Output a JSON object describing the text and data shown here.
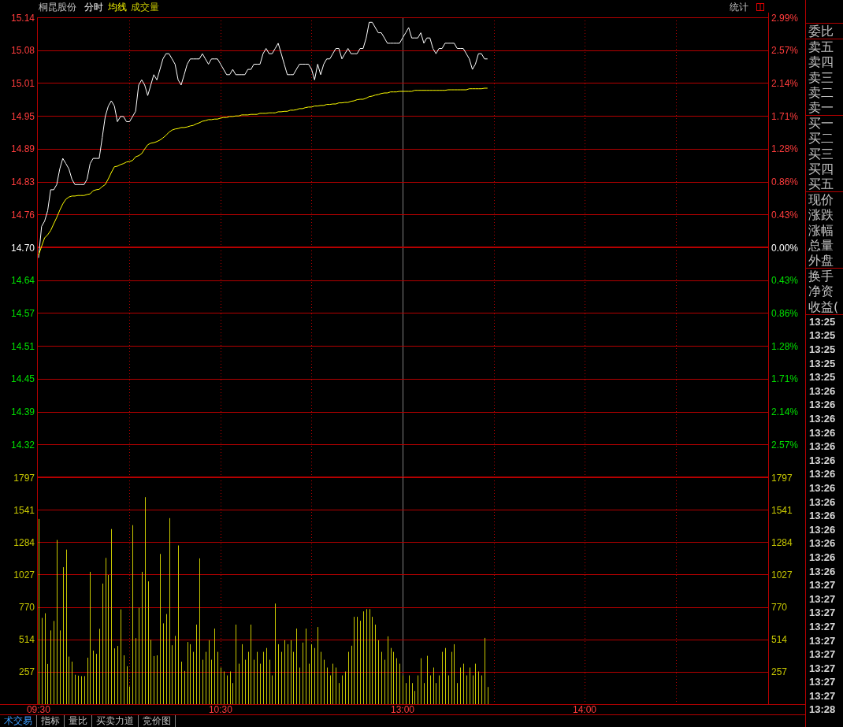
{
  "header": {
    "stock_name": "桐昆股份",
    "stats_label": "统计"
  },
  "price_chart": {
    "chart_data": {
      "type": "line",
      "grid": true,
      "categories": [
        null,
        null,
        null,
        null,
        null,
        null,
        null,
        null,
        null,
        null,
        null,
        null,
        null,
        null,
        null,
        null,
        null,
        null,
        null,
        null,
        null,
        null,
        null,
        null,
        null,
        null,
        null,
        null,
        null,
        null,
        null,
        null,
        null,
        null,
        null,
        null,
        null,
        null,
        null,
        null,
        null,
        null,
        null,
        null,
        null,
        null,
        null,
        null,
        null,
        null,
        null,
        null,
        null,
        null,
        null,
        null,
        null,
        null,
        null,
        null,
        null,
        null,
        null,
        null,
        null,
        null,
        null,
        null,
        null,
        null,
        null,
        null,
        null,
        null,
        null,
        null,
        null,
        null,
        null,
        null,
        null,
        null,
        null,
        null,
        null,
        null,
        null,
        null,
        null,
        null,
        null,
        null,
        null,
        null,
        null,
        null,
        null,
        null,
        null,
        null,
        null,
        null,
        null,
        null,
        null,
        null,
        null,
        null,
        null,
        null,
        null,
        null,
        null,
        null,
        null,
        null,
        null,
        null,
        null,
        null,
        null,
        null,
        null,
        null,
        null,
        null,
        null,
        null,
        null,
        null,
        null,
        null,
        null,
        null,
        null,
        null,
        null,
        null,
        null,
        null,
        null,
        null,
        null,
        null,
        null,
        null,
        null,
        null,
        null,
        null,
        null,
        null,
        null,
        null,
        null,
        null,
        null,
        null,
        null,
        null,
        null,
        null,
        null,
        null,
        null,
        null,
        null,
        null,
        null,
        null,
        null,
        null,
        null,
        null,
        null,
        null,
        null,
        null,
        null,
        null,
        null,
        null,
        null,
        null,
        null,
        null,
        null,
        null,
        null,
        null,
        null,
        null,
        null,
        null,
        null,
        null,
        null,
        null,
        null,
        null,
        null,
        null,
        null,
        null,
        null,
        null,
        null,
        null,
        null,
        null,
        null,
        null,
        null,
        null,
        null,
        null,
        null,
        null,
        null,
        null,
        null,
        null,
        null,
        null,
        null,
        null,
        null,
        null,
        null,
        null,
        null,
        null,
        null,
        null,
        null,
        null,
        null,
        null,
        null,
        null,
        null
      ],
      "ylim": [
        14.2605,
        15.1395
      ],
      "yticks": [
        {
          "value": 15.1395,
          "label": "15.14"
        },
        {
          "value": 15.0767,
          "label": "15.08"
        },
        {
          "value": 15.0139,
          "label": "15.01"
        },
        {
          "value": 14.9512,
          "label": "14.95"
        },
        {
          "value": 14.8884,
          "label": "14.89"
        },
        {
          "value": 14.8256,
          "label": "14.83"
        },
        {
          "value": 14.7628,
          "label": "14.76"
        },
        {
          "value": 14.7,
          "label": "14.70"
        },
        {
          "value": 14.6372,
          "label": "14.64"
        },
        {
          "value": 14.5744,
          "label": "14.57"
        },
        {
          "value": 14.5116,
          "label": "14.51"
        },
        {
          "value": 14.4488,
          "label": "14.45"
        },
        {
          "value": 14.386,
          "label": "14.39"
        },
        {
          "value": 14.3233,
          "label": "14.32"
        }
      ],
      "ref_lines": [
        {
          "axis": "y",
          "value": 14.7
        }
      ],
      "series": [
        {
          "name": "分时",
          "color": "#ffffff",
          "values": [
            14.68,
            14.74,
            14.75,
            14.77,
            14.81,
            14.81,
            14.82,
            14.85,
            14.87,
            14.86,
            14.85,
            14.83,
            14.82,
            14.82,
            14.82,
            14.82,
            14.83,
            14.86,
            14.87,
            14.87,
            14.87,
            14.91,
            14.95,
            14.97,
            14.98,
            14.97,
            14.94,
            14.95,
            14.95,
            14.94,
            14.94,
            14.95,
            14.96,
            15.01,
            15.02,
            15.01,
            14.99,
            15.01,
            15.03,
            15.02,
            15.04,
            15.06,
            15.07,
            15.07,
            15.06,
            15.05,
            15.02,
            15.01,
            15.03,
            15.05,
            15.06,
            15.06,
            15.06,
            15.06,
            15.07,
            15.06,
            15.05,
            15.06,
            15.06,
            15.06,
            15.05,
            15.04,
            15.03,
            15.03,
            15.04,
            15.03,
            15.03,
            15.03,
            15.03,
            15.04,
            15.04,
            15.05,
            15.05,
            15.05,
            15.07,
            15.08,
            15.07,
            15.07,
            15.08,
            15.09,
            15.07,
            15.05,
            15.03,
            15.03,
            15.03,
            15.04,
            15.05,
            15.05,
            15.05,
            15.05,
            15.04,
            15.02,
            15.05,
            15.03,
            15.05,
            15.06,
            15.06,
            15.07,
            15.08,
            15.08,
            15.06,
            15.07,
            15.08,
            15.07,
            15.07,
            15.07,
            15.08,
            15.08,
            15.1,
            15.13,
            15.13,
            15.12,
            15.11,
            15.11,
            15.1,
            15.09,
            15.09,
            15.09,
            15.09,
            15.09,
            15.1,
            15.11,
            15.12,
            15.1,
            15.1,
            15.1,
            15.11,
            15.09,
            15.1,
            15.1,
            15.08,
            15.07,
            15.08,
            15.08,
            15.09,
            15.09,
            15.09,
            15.09,
            15.08,
            15.08,
            15.08,
            15.07,
            15.06,
            15.04,
            15.05,
            15.07,
            15.07,
            15.06,
            15.06,
            null,
            null,
            null,
            null,
            null,
            null,
            null,
            null,
            null,
            null,
            null,
            null,
            null,
            null,
            null,
            null,
            null,
            null,
            null,
            null,
            null,
            null,
            null,
            null,
            null,
            null,
            null,
            null,
            null,
            null,
            null,
            null,
            null,
            null,
            null,
            null,
            null,
            null,
            null,
            null,
            null,
            null,
            null,
            null,
            null,
            null,
            null,
            null,
            null,
            null,
            null,
            null,
            null,
            null,
            null,
            null,
            null,
            null,
            null,
            null,
            null,
            null,
            null,
            null,
            null,
            null,
            null,
            null,
            null,
            null,
            null,
            null,
            null,
            null,
            null,
            null,
            null,
            null,
            null,
            null,
            null,
            null,
            null,
            null,
            null,
            null,
            null,
            null,
            null,
            null,
            null,
            null
          ]
        },
        {
          "name": "均线",
          "color": "#ffff00",
          "values": [
            14.685,
            14.702,
            14.718,
            14.724,
            14.732,
            14.745,
            14.757,
            14.771,
            14.783,
            14.792,
            14.796,
            14.798,
            14.798,
            14.799,
            14.799,
            14.799,
            14.801,
            14.802,
            14.808,
            14.81,
            14.811,
            14.816,
            14.82,
            14.831,
            14.843,
            14.854,
            14.855,
            14.858,
            14.86,
            14.863,
            14.864,
            14.866,
            14.873,
            14.875,
            14.879,
            14.888,
            14.896,
            14.899,
            14.9,
            14.902,
            14.905,
            14.909,
            14.914,
            14.92,
            14.924,
            14.926,
            14.927,
            14.929,
            14.929,
            14.93,
            14.932,
            14.933,
            14.936,
            14.938,
            14.941,
            14.942,
            14.944,
            14.944,
            14.945,
            14.945,
            14.947,
            14.948,
            14.948,
            14.95,
            14.95,
            14.951,
            14.951,
            14.953,
            14.953,
            14.953,
            14.954,
            14.954,
            14.954,
            14.956,
            14.956,
            14.956,
            14.957,
            14.957,
            14.957,
            14.959,
            14.959,
            14.96,
            14.96,
            14.962,
            14.962,
            14.963,
            14.965,
            14.965,
            14.967,
            14.968,
            14.968,
            14.97,
            14.97,
            14.971,
            14.971,
            14.973,
            14.973,
            14.974,
            14.974,
            14.976,
            14.976,
            14.977,
            14.977,
            14.979,
            14.98,
            14.982,
            14.983,
            14.983,
            14.985,
            14.988,
            14.989,
            14.991,
            14.992,
            14.994,
            14.995,
            14.995,
            14.997,
            14.997,
            14.997,
            14.998,
            14.998,
            14.998,
            14.998,
            14.998,
            15.0,
            15.0,
            15.0,
            15.0,
            15.0,
            15.0,
            15.0,
            15.0,
            15.0,
            15.0,
            15.0,
            15.001,
            15.001,
            15.001,
            15.001,
            15.001,
            15.001,
            15.001,
            15.003,
            15.003,
            15.003,
            15.003,
            15.003,
            15.004,
            15.004,
            null,
            null,
            null,
            null,
            null,
            null,
            null,
            null,
            null,
            null,
            null,
            null,
            null,
            null,
            null,
            null,
            null,
            null,
            null,
            null,
            null,
            null,
            null,
            null,
            null,
            null,
            null,
            null,
            null,
            null,
            null,
            null,
            null,
            null,
            null,
            null,
            null,
            null,
            null,
            null,
            null,
            null,
            null,
            null,
            null,
            null,
            null,
            null,
            null,
            null,
            null,
            null,
            null,
            null,
            null,
            null,
            null,
            null,
            null,
            null,
            null,
            null,
            null,
            null,
            null,
            null,
            null,
            null,
            null,
            null,
            null,
            null,
            null,
            null,
            null,
            null,
            null,
            null,
            null,
            null,
            null,
            null,
            null,
            null,
            null,
            null,
            null,
            null,
            null,
            null,
            null,
            null
          ]
        }
      ]
    },
    "right_axis_labels": [
      {
        "text": "2.99%",
        "kind": "up"
      },
      {
        "text": "2.57%",
        "kind": "up"
      },
      {
        "text": "2.14%",
        "kind": "up"
      },
      {
        "text": "1.71%",
        "kind": "up"
      },
      {
        "text": "1.28%",
        "kind": "up"
      },
      {
        "text": "0.86%",
        "kind": "up"
      },
      {
        "text": "0.43%",
        "kind": "up"
      },
      {
        "text": "0.00%",
        "kind": "flat"
      },
      {
        "text": "0.43%",
        "kind": "down"
      },
      {
        "text": "0.86%",
        "kind": "down"
      },
      {
        "text": "1.28%",
        "kind": "down"
      },
      {
        "text": "1.71%",
        "kind": "down"
      },
      {
        "text": "2.14%",
        "kind": "down"
      },
      {
        "text": "2.57%",
        "kind": "down"
      }
    ]
  },
  "volume_chart": {
    "chart_data": {
      "type": "bar",
      "title": "成交量",
      "grid": true,
      "categories": [
        "09:30",
        null,
        null,
        null,
        null,
        null,
        null,
        null,
        null,
        null,
        null,
        null,
        null,
        null,
        null,
        null,
        null,
        null,
        null,
        null,
        null,
        null,
        null,
        null,
        null,
        null,
        null,
        null,
        null,
        null,
        null,
        null,
        null,
        null,
        null,
        null,
        null,
        null,
        null,
        null,
        null,
        null,
        null,
        null,
        null,
        null,
        null,
        null,
        null,
        null,
        null,
        null,
        null,
        null,
        null,
        null,
        null,
        null,
        null,
        null,
        "10:30",
        null,
        null,
        null,
        null,
        null,
        null,
        null,
        null,
        null,
        null,
        null,
        null,
        null,
        null,
        null,
        null,
        null,
        null,
        null,
        null,
        null,
        null,
        null,
        null,
        null,
        null,
        null,
        null,
        null,
        null,
        null,
        null,
        null,
        null,
        null,
        null,
        null,
        null,
        null,
        null,
        null,
        null,
        null,
        null,
        null,
        null,
        null,
        null,
        null,
        null,
        null,
        null,
        null,
        null,
        null,
        null,
        null,
        null,
        null,
        "13:00",
        null,
        null,
        null,
        null,
        null,
        null,
        null,
        null,
        null,
        null,
        null,
        null,
        null,
        null,
        null,
        null,
        null,
        null,
        null,
        null,
        null,
        null,
        null,
        null,
        null,
        null,
        null,
        null,
        null,
        null,
        null,
        null,
        null,
        null,
        null,
        null,
        null,
        null,
        null,
        null,
        null,
        null,
        null,
        null,
        null,
        null,
        null,
        null,
        null,
        null,
        null,
        null,
        null,
        null,
        null,
        null,
        null,
        null,
        null,
        "14:00",
        null,
        null,
        null,
        null,
        null,
        null,
        null,
        null,
        null,
        null,
        null,
        null,
        null,
        null,
        null,
        null,
        null,
        null,
        null,
        null,
        null,
        null,
        null,
        null,
        null,
        null,
        null,
        null,
        null,
        null,
        null,
        null,
        null,
        null,
        null,
        null,
        null,
        null,
        null,
        null,
        null,
        null,
        null,
        null,
        null,
        null,
        null,
        null,
        null,
        null,
        null,
        null,
        null,
        null,
        null,
        null,
        null,
        null,
        null,
        null
      ],
      "ylim": [
        0,
        1797
      ],
      "yticks": [
        1797,
        1541,
        1284,
        1027,
        770,
        514,
        257
      ],
      "series": [
        {
          "color": "#c8c800",
          "values": [
            1467,
            683,
            720,
            319,
            584,
            659,
            1301,
            584,
            1085,
            1225,
            377,
            337,
            233,
            226,
            222,
            222,
            368,
            1048,
            424,
            399,
            597,
            955,
            1159,
            1023,
            1387,
            442,
            461,
            751,
            387,
            300,
            140,
            1418,
            523,
            763,
            1048,
            1640,
            973,
            510,
            381,
            387,
            1190,
            640,
            714,
            1474,
            467,
            541,
            1257,
            337,
            263,
            492,
            475,
            414,
            630,
            1155,
            352,
            414,
            506,
            352,
            599,
            414,
            290,
            259,
            228,
            259,
            167,
            630,
            321,
            475,
            352,
            414,
            630,
            352,
            414,
            321,
            414,
            445,
            352,
            228,
            797,
            475,
            414,
            506,
            475,
            506,
            414,
            599,
            290,
            488,
            599,
            321,
            475,
            445,
            611,
            414,
            352,
            290,
            228,
            321,
            290,
            167,
            228,
            259,
            414,
            463,
            692,
            692,
            661,
            735,
            753,
            753,
            692,
            630,
            506,
            414,
            352,
            537,
            445,
            414,
            364,
            321,
            228,
            167,
            228,
            167,
            105,
            228,
            364,
            167,
            383,
            228,
            290,
            167,
            228,
            414,
            445,
            228,
            414,
            475,
            167,
            290,
            321,
            228,
            290,
            228,
            321,
            259,
            228,
            525,
            136,
            null,
            null,
            null,
            null,
            null,
            null,
            null,
            null,
            null,
            null,
            null,
            null,
            null,
            null,
            null,
            null,
            null,
            null,
            null,
            null,
            null,
            null,
            null,
            null,
            null,
            null,
            null,
            null,
            null,
            null,
            null,
            null,
            null,
            null,
            null,
            null,
            null,
            null,
            null,
            null,
            null,
            null,
            null,
            null,
            null,
            null,
            null,
            null,
            null,
            null,
            null,
            null,
            null,
            null,
            null,
            null,
            null,
            null,
            null,
            null,
            null,
            null,
            null,
            null,
            null,
            null,
            null,
            null,
            null,
            null,
            null,
            null,
            null,
            null,
            null,
            null,
            null,
            null,
            null,
            null,
            null,
            null,
            null,
            null,
            null,
            null,
            null,
            null,
            null,
            null,
            null,
            null
          ]
        }
      ]
    },
    "right_axis_labels": [
      "1797",
      "1541",
      "1284",
      "1027",
      "770",
      "514",
      "257"
    ]
  },
  "bottom_tabs": [
    {
      "label": "术交易",
      "selected": true
    },
    {
      "label": "指标",
      "selected": false
    },
    {
      "label": "量比",
      "selected": false
    },
    {
      "label": "买卖力道",
      "selected": false
    },
    {
      "label": "竞价图",
      "selected": false
    }
  ],
  "quote_panel": {
    "groups": [
      [
        "委比"
      ],
      [
        "卖五",
        "卖四",
        "卖三",
        "卖二",
        "卖一"
      ],
      [
        "买一",
        "买二",
        "买三",
        "买四",
        "买五"
      ],
      [
        "现价",
        "涨跌",
        "涨幅",
        "总量",
        "外盘"
      ],
      [
        "换手",
        "净资",
        "收益("
      ]
    ],
    "trade_times": [
      "13:25",
      "13:25",
      "13:25",
      "13:25",
      "13:25",
      "13:26",
      "13:26",
      "13:26",
      "13:26",
      "13:26",
      "13:26",
      "13:26",
      "13:26",
      "13:26",
      "13:26",
      "13:26",
      "13:26",
      "13:26",
      "13:26",
      "13:27",
      "13:27",
      "13:27",
      "13:27",
      "13:27",
      "13:27",
      "13:27",
      "13:27",
      "13:27",
      "13:28"
    ]
  }
}
